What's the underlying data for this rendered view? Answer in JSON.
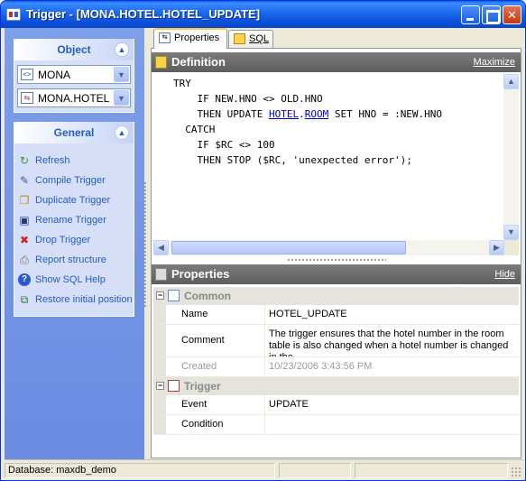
{
  "window": {
    "title": "Trigger - [MONA.HOTEL.HOTEL_UPDATE]",
    "minimize_icon": "minimize-icon",
    "maximize_icon": "maximize-icon",
    "close_icon": "close-icon"
  },
  "nav": {
    "object_group": {
      "title": "Object",
      "database_combo": "MONA",
      "object_combo": "MONA.HOTEL.H"
    },
    "general_group": {
      "title": "General",
      "items": [
        {
          "label": "Refresh",
          "icon": "refresh-icon"
        },
        {
          "label": "Compile Trigger",
          "icon": "compile-icon"
        },
        {
          "label": "Duplicate Trigger",
          "icon": "duplicate-icon"
        },
        {
          "label": "Rename Trigger",
          "icon": "rename-icon"
        },
        {
          "label": "Drop Trigger",
          "icon": "drop-icon"
        },
        {
          "label": "Report structure",
          "icon": "report-icon"
        },
        {
          "label": "Show SQL Help",
          "icon": "help-icon"
        },
        {
          "label": "Restore initial position",
          "icon": "restore-icon"
        }
      ]
    }
  },
  "tabs": [
    {
      "label": "Properties",
      "active": true
    },
    {
      "label": "SQL",
      "active": false
    }
  ],
  "definition": {
    "title": "Definition",
    "action": "Maximize",
    "code": [
      {
        "parts": [
          {
            "t": "TRY"
          }
        ]
      },
      {
        "parts": [
          {
            "t": "    IF NEW.HNO <> OLD.HNO"
          }
        ]
      },
      {
        "parts": [
          {
            "t": "    THEN UPDATE "
          },
          {
            "t": "HOTEL",
            "link": true
          },
          {
            "t": "."
          },
          {
            "t": "ROOM",
            "link": true
          },
          {
            "t": " SET HNO = :NEW.HNO"
          }
        ]
      },
      {
        "parts": [
          {
            "t": "  CATCH"
          }
        ]
      },
      {
        "parts": [
          {
            "t": "    IF $RC <> 100"
          }
        ]
      },
      {
        "parts": [
          {
            "t": "    THEN STOP ($RC, 'unexpected error');"
          }
        ]
      }
    ]
  },
  "properties": {
    "title": "Properties",
    "action": "Hide",
    "common": {
      "title": "Common",
      "name_label": "Name",
      "name_value": "HOTEL_UPDATE",
      "comment_label": "Comment",
      "comment_value": "The trigger ensures that the hotel number in the room table is also changed when a hotel number is changed in the",
      "created_label": "Created",
      "created_value": "10/23/2006 3:43:56 PM"
    },
    "trigger": {
      "title": "Trigger",
      "event_label": "Event",
      "event_value": "UPDATE",
      "condition_label": "Condition",
      "condition_value": ""
    }
  },
  "status": {
    "database": "Database: maxdb_demo"
  }
}
